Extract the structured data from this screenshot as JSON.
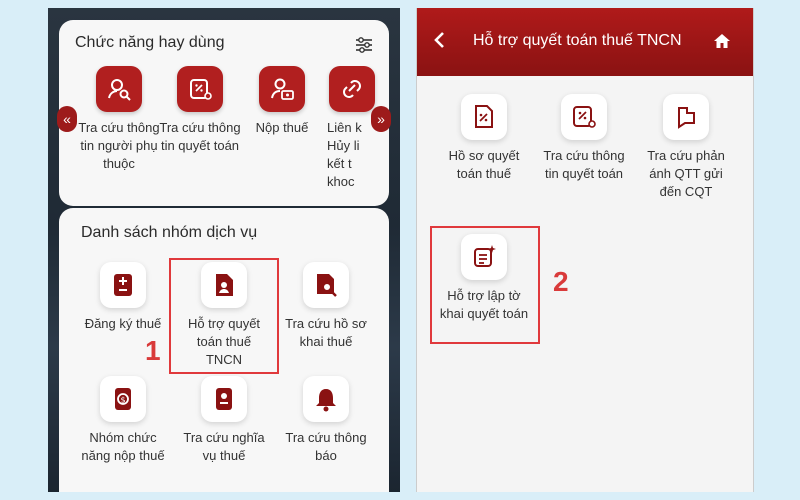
{
  "left": {
    "favorites": {
      "title": "Chức năng hay dùng",
      "items": [
        {
          "label": "Tra cứu thông tin người phụ thuộc",
          "icon": "person-search-icon"
        },
        {
          "label": "Tra cứu thông tin quyết toán",
          "icon": "settlement-info-icon"
        },
        {
          "label": "Nộp thuế",
          "icon": "pay-tax-icon"
        },
        {
          "label": "Liên k Hủy li kết t khoc",
          "icon": "link-icon"
        }
      ]
    },
    "services": {
      "title": "Danh sách nhóm dịch vụ",
      "items": [
        {
          "label": "Đăng ký thuế",
          "icon": "tax-register-icon"
        },
        {
          "label": "Hỗ trợ quyết toán thuế TNCN",
          "icon": "tax-settlement-icon"
        },
        {
          "label": "Tra cứu hồ sơ khai thuế",
          "icon": "doc-search-icon"
        },
        {
          "label": "Nhóm chức năng nộp thuế",
          "icon": "payment-group-icon"
        },
        {
          "label": "Tra cứu nghĩa vụ thuế",
          "icon": "obligation-icon"
        },
        {
          "label": "Tra cứu thông báo",
          "icon": "bell-icon"
        }
      ]
    },
    "step_label": "1"
  },
  "right": {
    "header_title": "Hỗ trợ quyết toán thuế TNCN",
    "items": [
      {
        "label": "Hồ sơ quyết toán thuế",
        "icon": "settlement-file-icon"
      },
      {
        "label": "Tra cứu thông tin quyết toán",
        "icon": "settlement-info-icon"
      },
      {
        "label": "Tra cứu phản ánh QTT gửi đến CQT",
        "icon": "feedback-icon"
      },
      {
        "label": "Hỗ trợ lập tờ khai quyết toán",
        "icon": "declaration-assist-icon"
      }
    ],
    "step_label": "2"
  },
  "colors": {
    "accent": "#b11f1f",
    "highlight": "#e0393c",
    "background": "#d9eef8"
  }
}
